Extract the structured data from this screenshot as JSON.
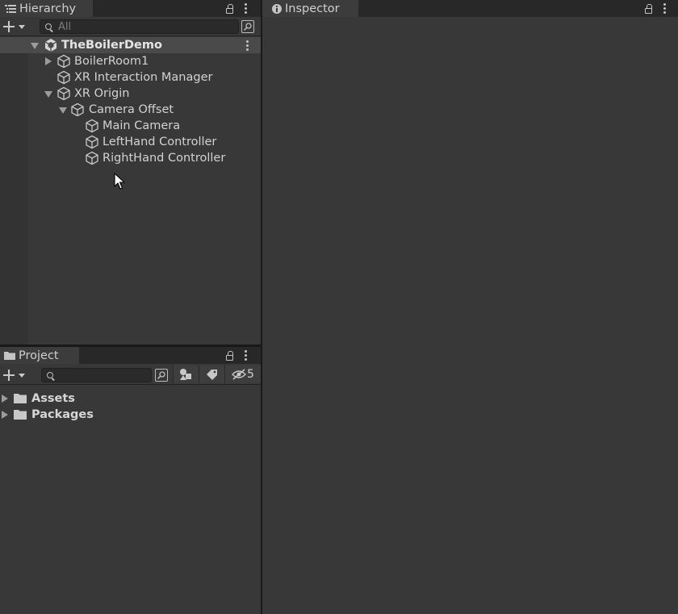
{
  "hierarchy": {
    "tab_label": "Hierarchy",
    "search_placeholder": "All",
    "scene": "TheBoilerDemo",
    "items": [
      {
        "label": "BoilerRoom1",
        "fold": "closed"
      },
      {
        "label": "XR Interaction Manager",
        "fold": "none"
      },
      {
        "label": "XR Origin",
        "fold": "open"
      },
      {
        "label": "Camera Offset",
        "fold": "open"
      },
      {
        "label": "Main Camera",
        "fold": "none"
      },
      {
        "label": "LeftHand Controller",
        "fold": "none"
      },
      {
        "label": "RightHand Controller",
        "fold": "none"
      }
    ]
  },
  "project": {
    "tab_label": "Project",
    "hidden_count": "5",
    "items": [
      {
        "label": "Assets"
      },
      {
        "label": "Packages"
      }
    ]
  },
  "inspector": {
    "tab_label": "Inspector"
  },
  "icons": {
    "hierarchy_tab": "list-icon",
    "scene": "unity-scene-icon",
    "gameobject": "cube-icon",
    "project_tab": "folder-icon",
    "inspector_tab": "info-icon"
  }
}
